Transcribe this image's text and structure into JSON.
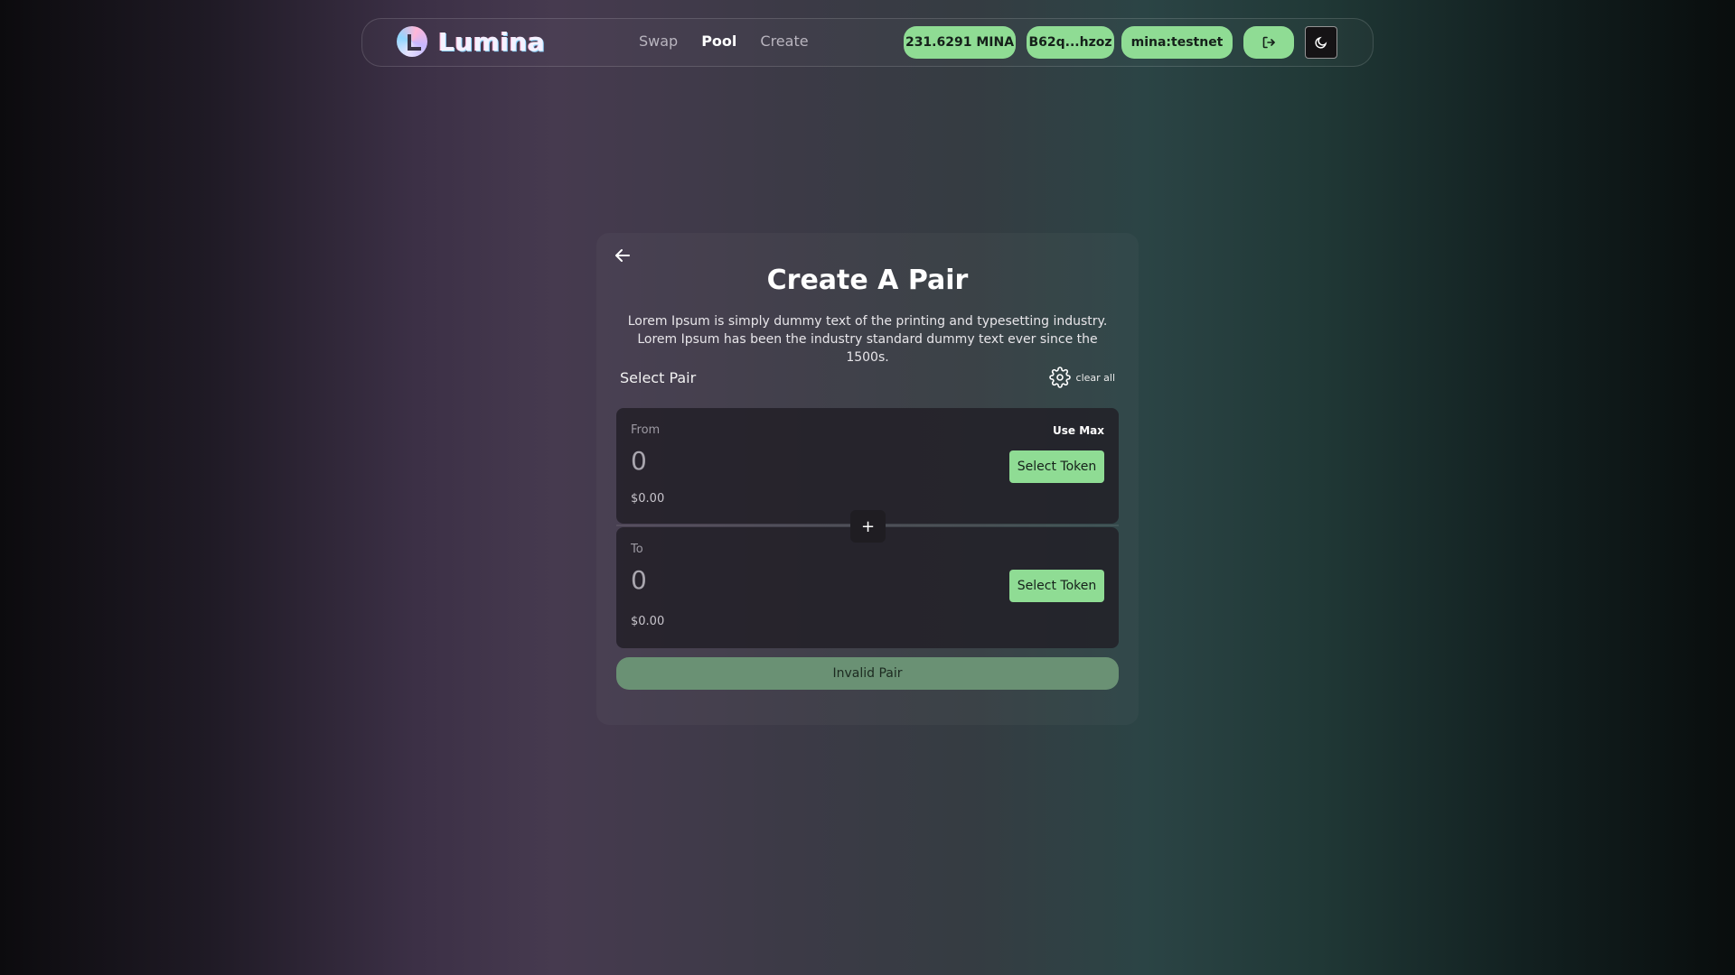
{
  "header": {
    "logo_text": "Lumina",
    "nav": [
      "Swap",
      "Pool",
      "Create"
    ],
    "active_nav": "Pool",
    "balance": "231.6291 MINA",
    "address": "B62q...hzoz",
    "network": "mina:testnet",
    "logout_icon": "logout-icon",
    "theme_icon": "moon-icon"
  },
  "card": {
    "title": "Create A Pair",
    "description": "Lorem Ipsum is simply dummy text of the printing and typesetting industry. Lorem Ipsum has been the industry standard dummy text ever since the 1500s.",
    "select_pair_label": "Select Pair",
    "clear_all_label": "clear all",
    "from": {
      "label": "From",
      "amount": "0",
      "usd": "$0.00",
      "use_max": "Use Max",
      "select_token": "Select Token"
    },
    "to": {
      "label": "To",
      "amount": "0",
      "usd": "$0.00",
      "select_token": "Select Token"
    },
    "plus_symbol": "+",
    "submit_label": "Invalid Pair"
  },
  "colors": {
    "accent": "#8fdc94",
    "submit_disabled": "#6a9174"
  }
}
